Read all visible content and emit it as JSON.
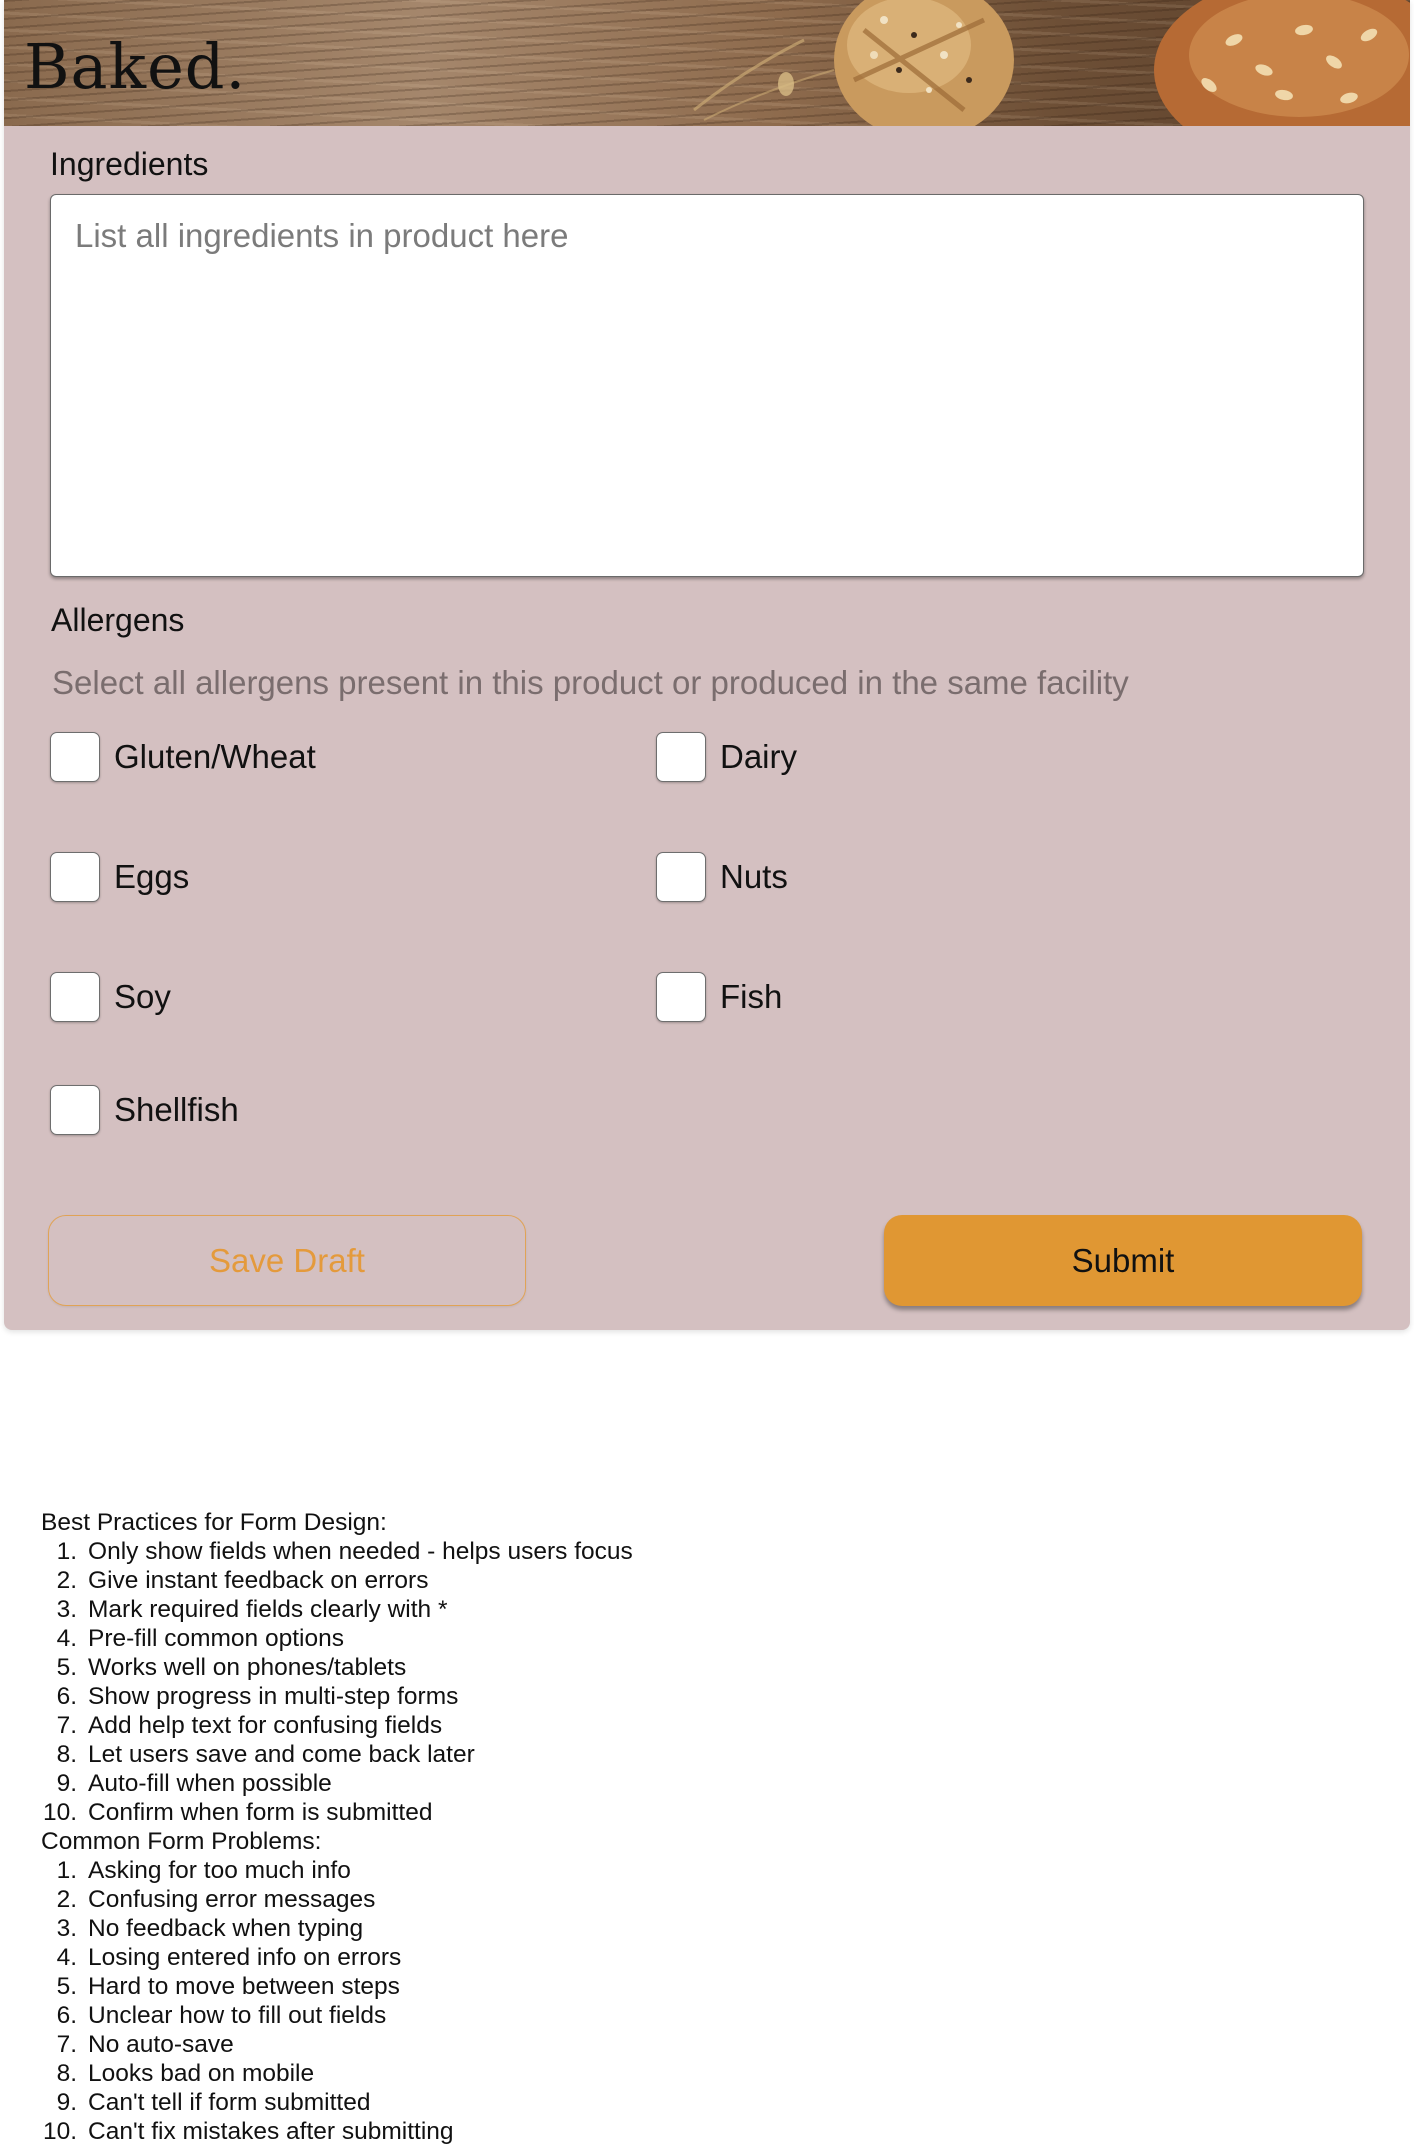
{
  "header": {
    "logo_text": "Baked."
  },
  "form": {
    "ingredients_label": "Ingredients",
    "ingredients_placeholder": "List all ingredients in product here",
    "allergens_label": "Allergens",
    "allergens_hint": "Select all allergens present in this product or produced in the same facility",
    "allergens": [
      {
        "label": "Gluten/Wheat",
        "checked": false
      },
      {
        "label": "Dairy",
        "checked": false
      },
      {
        "label": "Eggs",
        "checked": false
      },
      {
        "label": "Nuts",
        "checked": false
      },
      {
        "label": "Soy",
        "checked": false
      },
      {
        "label": "Fish",
        "checked": false
      },
      {
        "label": "Shellfish",
        "checked": false
      }
    ],
    "save_draft_label": "Save Draft",
    "submit_label": "Submit"
  },
  "notes": {
    "best_practices_heading": "Best Practices for Form Design:",
    "best_practices": [
      "Only show fields when needed - helps users focus",
      "Give instant feedback on errors",
      "Mark required fields clearly with *",
      "Pre-fill common options",
      "Works well on phones/tablets",
      "Show progress in multi-step forms",
      "Add help text for confusing fields",
      "Let users save and come back later",
      "Auto-fill when possible",
      "Confirm when form is submitted"
    ],
    "problems_heading": "Common Form Problems:",
    "problems": [
      "Asking for too much info",
      "Confusing error messages",
      "No feedback when typing",
      "Losing entered info on errors",
      "Hard to move between steps",
      "Unclear how to fill out fields",
      "No auto-save",
      "Looks bad on mobile",
      "Can't tell if form submitted",
      "Can't fix mistakes after submitting"
    ]
  },
  "colors": {
    "card_background": "#d4c0c1",
    "accent": "#e09733",
    "draft_text": "#e49a3c"
  }
}
